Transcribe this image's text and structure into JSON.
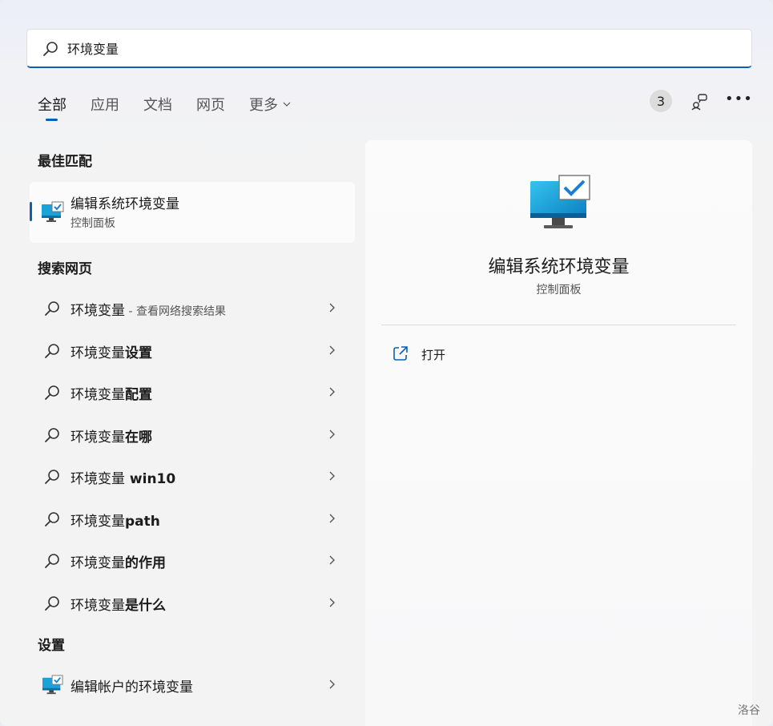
{
  "search": {
    "value": "环境变量",
    "icon": "search-icon"
  },
  "tabs": [
    {
      "label": "全部",
      "active": true
    },
    {
      "label": "应用",
      "active": false
    },
    {
      "label": "文档",
      "active": false
    },
    {
      "label": "网页",
      "active": false
    },
    {
      "label": "更多",
      "active": false
    }
  ],
  "toolbar": {
    "badge_count": "3",
    "feedback_icon": "feedback-icon",
    "more_icon": "more-icon"
  },
  "sections": {
    "best_match": "最佳匹配",
    "web": "搜索网页",
    "settings": "设置"
  },
  "best_match": {
    "title": "编辑系统环境变量",
    "subtitle": "控制面板"
  },
  "web_results": [
    {
      "prefix": "环境变量",
      "bold": "",
      "hint": " - 查看网络搜索结果"
    },
    {
      "prefix": "环境变量",
      "bold": "设置",
      "hint": ""
    },
    {
      "prefix": "环境变量",
      "bold": "配置",
      "hint": ""
    },
    {
      "prefix": "环境变量",
      "bold": "在哪",
      "hint": ""
    },
    {
      "prefix": "环境变量",
      "bold": " win10",
      "hint": ""
    },
    {
      "prefix": "环境变量",
      "bold": "path",
      "hint": ""
    },
    {
      "prefix": "环境变量",
      "bold": "的作用",
      "hint": ""
    },
    {
      "prefix": "环境变量",
      "bold": "是什么",
      "hint": ""
    }
  ],
  "settings_results": [
    {
      "label": "编辑帐户的环境变量"
    }
  ],
  "detail": {
    "title": "编辑系统环境变量",
    "subtitle": "控制面板",
    "action_open": "打开"
  },
  "watermark": "洛谷",
  "colors": {
    "accent": "#0a5fb6"
  }
}
